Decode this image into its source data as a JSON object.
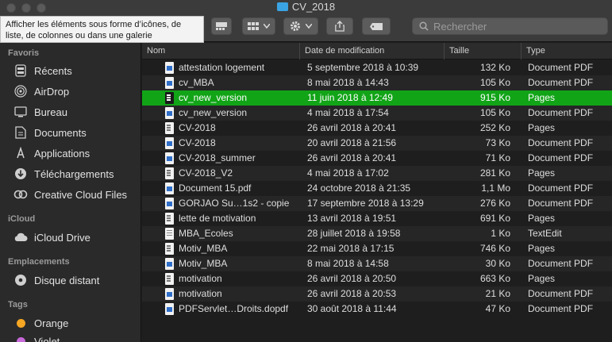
{
  "window": {
    "title": "CV_2018"
  },
  "toolbar": {
    "tooltip": "Afficher les éléments sous forme d’icônes, de liste, de colonnes ou dans une galerie",
    "search_placeholder": "Rechercher"
  },
  "sidebar": {
    "favorites_header": "Favoris",
    "favorites": [
      {
        "label": "Récents",
        "icon": "recents-icon"
      },
      {
        "label": "AirDrop",
        "icon": "airdrop-icon"
      },
      {
        "label": "Bureau",
        "icon": "desktop-icon"
      },
      {
        "label": "Documents",
        "icon": "documents-icon"
      },
      {
        "label": "Applications",
        "icon": "applications-icon"
      },
      {
        "label": "Téléchargements",
        "icon": "downloads-icon"
      },
      {
        "label": "Creative Cloud Files",
        "icon": "creative-cloud-icon"
      }
    ],
    "icloud_header": "iCloud",
    "icloud": [
      {
        "label": "iCloud Drive",
        "icon": "cloud-icon"
      }
    ],
    "locations_header": "Emplacements",
    "locations": [
      {
        "label": "Disque distant",
        "icon": "disc-icon"
      }
    ],
    "tags_header": "Tags",
    "tags": [
      {
        "label": "Orange",
        "color": "#f5a623"
      },
      {
        "label": "Violet",
        "color": "#c86ad9"
      }
    ]
  },
  "list": {
    "columns": {
      "name": "Nom",
      "date": "Date de modification",
      "size": "Taille",
      "kind": "Type"
    },
    "rows": [
      {
        "name": "attestation logement",
        "date": "5 septembre 2018 à 10:39",
        "size": "132 Ko",
        "kind": "Document PDF",
        "icon": "pdf"
      },
      {
        "name": "cv_MBA",
        "date": "8 mai 2018 à 14:43",
        "size": "105 Ko",
        "kind": "Document PDF",
        "icon": "pdf"
      },
      {
        "name": "cv_new_version",
        "date": "11 juin 2018 à 12:49",
        "size": "915 Ko",
        "kind": "Pages",
        "icon": "pages",
        "selected": true
      },
      {
        "name": "cv_new_version",
        "date": "4 mai 2018 à 17:54",
        "size": "105 Ko",
        "kind": "Document PDF",
        "icon": "pdf"
      },
      {
        "name": "CV-2018",
        "date": "26 avril 2018 à 20:41",
        "size": "252 Ko",
        "kind": "Pages",
        "icon": "pages"
      },
      {
        "name": "CV-2018",
        "date": "20 avril 2018 à 21:56",
        "size": "73 Ko",
        "kind": "Document PDF",
        "icon": "pdf"
      },
      {
        "name": "CV-2018_summer",
        "date": "26 avril 2018 à 20:41",
        "size": "71 Ko",
        "kind": "Document PDF",
        "icon": "pdf"
      },
      {
        "name": "CV-2018_V2",
        "date": "4 mai 2018 à 17:02",
        "size": "281 Ko",
        "kind": "Pages",
        "icon": "pages"
      },
      {
        "name": "Document 15.pdf",
        "date": "24 octobre 2018 à 21:35",
        "size": "1,1 Mo",
        "kind": "Document PDF",
        "icon": "pdf"
      },
      {
        "name": "GORJAO Su…1s2 - copie",
        "date": "17 septembre 2018 à 13:29",
        "size": "276 Ko",
        "kind": "Document PDF",
        "icon": "pdf"
      },
      {
        "name": "lette de motivation",
        "date": "13 avril 2018 à 19:51",
        "size": "691 Ko",
        "kind": "Pages",
        "icon": "pages"
      },
      {
        "name": "MBA_Ecoles",
        "date": "28 juillet 2018 à 19:58",
        "size": "1 Ko",
        "kind": "TextEdit",
        "icon": "txt"
      },
      {
        "name": "Motiv_MBA",
        "date": "22 mai 2018 à 17:15",
        "size": "746 Ko",
        "kind": "Pages",
        "icon": "pages"
      },
      {
        "name": "Motiv_MBA",
        "date": "8 mai 2018 à 14:58",
        "size": "30 Ko",
        "kind": "Document PDF",
        "icon": "pdf"
      },
      {
        "name": "motivation",
        "date": "26 avril 2018 à 20:50",
        "size": "663 Ko",
        "kind": "Pages",
        "icon": "pages"
      },
      {
        "name": "motivation",
        "date": "26 avril 2018 à 20:53",
        "size": "21 Ko",
        "kind": "Document PDF",
        "icon": "pdf"
      },
      {
        "name": "PDFServlet…Droits.dopdf",
        "date": "30 août 2018 à 11:44",
        "size": "47 Ko",
        "kind": "Document PDF",
        "icon": "pdf"
      }
    ]
  }
}
